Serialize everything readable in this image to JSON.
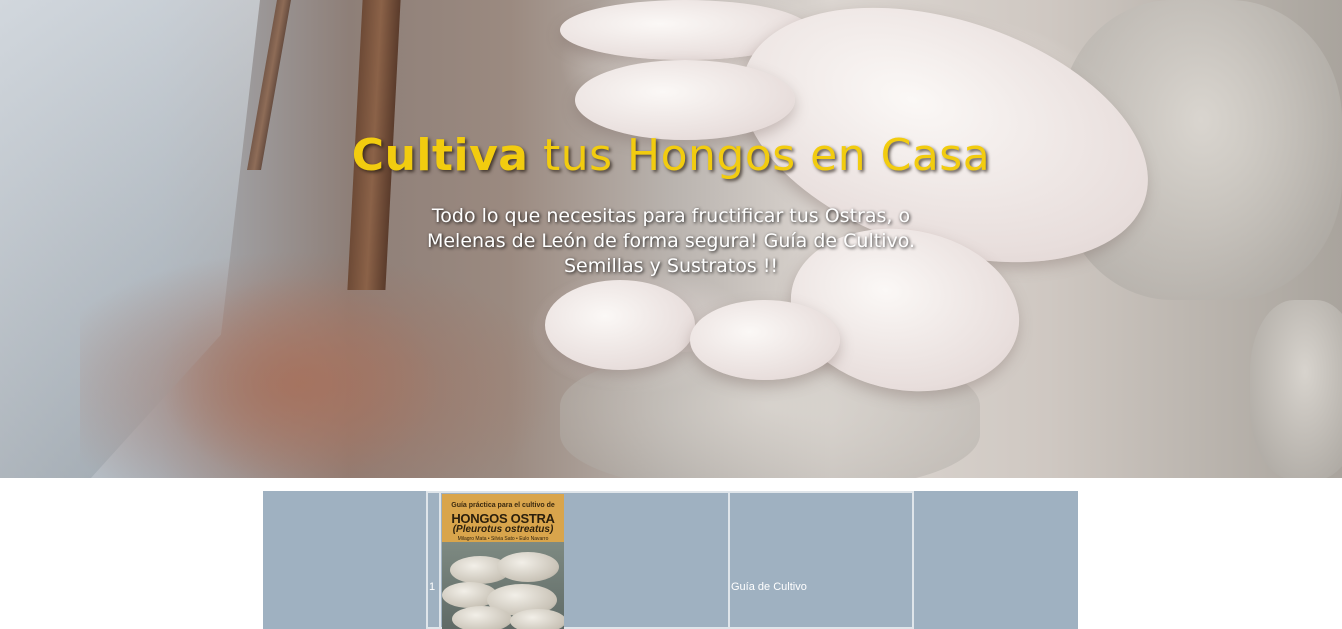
{
  "hero": {
    "title_bold": "Cultiva",
    "title_rest": " tus Hongos en Casa",
    "subtitle": "Todo lo que necesitas para fructificar tus Ostras, o Melenas de León de forma segura! Guía de Cultivo. Semillas y Sustratos !!",
    "title_color": "#f2cc0f"
  },
  "strip": {
    "background_color": "#9fb1c1",
    "item_number": "1",
    "book": {
      "line1": "Guía práctica para el cultivo de",
      "title": "HONGOS OSTRA",
      "subtitle": "(Pleurotus ostreatus)",
      "authors": "Milagro Mata • Silvia Sato • Eulo Navarro"
    },
    "link_label": "Guía de Cultivo"
  }
}
